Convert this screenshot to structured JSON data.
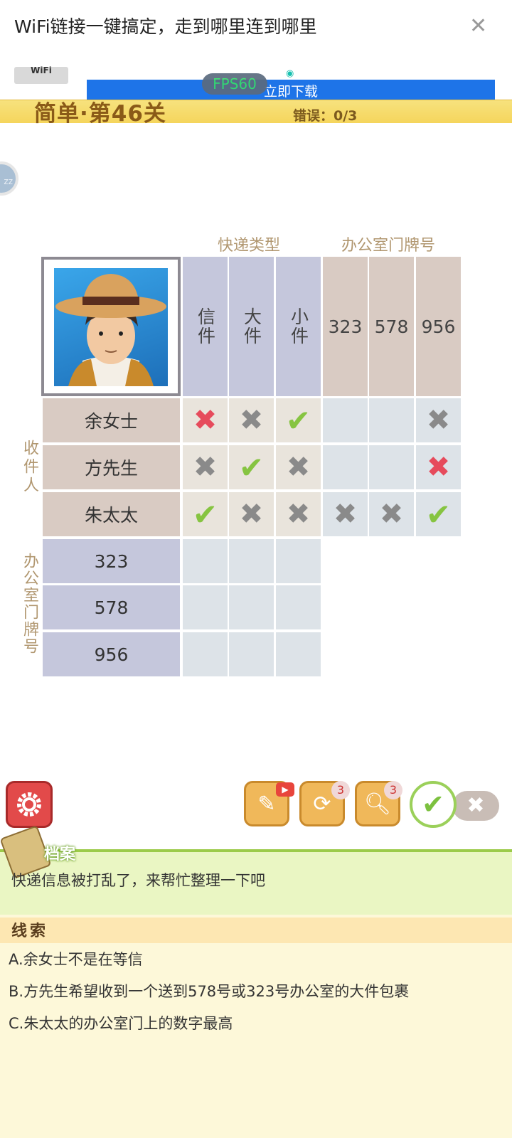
{
  "ad": {
    "title": "WiFi链接一键搞定，走到哪里连到哪里",
    "logo_text": "WiFi",
    "download_button": "立即下载",
    "close_icon": "close-icon"
  },
  "overlay": {
    "fps": "FPS60"
  },
  "level": {
    "title": "简单·第46关",
    "errors": "错误：0/3"
  },
  "grid": {
    "type_group_label": "快递类型",
    "room_group_label": "办公室门牌号",
    "type_columns": [
      "信件",
      "大件",
      "小件"
    ],
    "room_columns": [
      "323",
      "578",
      "956"
    ],
    "recipient_label": "收件人",
    "room_row_label": "办公室门牌号",
    "recipients": [
      "余女士",
      "方先生",
      "朱太太"
    ],
    "room_rows": [
      "323",
      "578",
      "956"
    ],
    "marks": {
      "row0": [
        "x-red",
        "x",
        "check",
        "",
        "",
        "x"
      ],
      "row1": [
        "x",
        "check",
        "x",
        "",
        "",
        "x-red"
      ],
      "row2": [
        "check",
        "x",
        "x",
        "x",
        "x",
        "check"
      ]
    },
    "mark_symbols": {
      "x": "✖",
      "x-red": "✖",
      "check": "✔"
    }
  },
  "toolbar": {
    "settings_icon": "gear-icon",
    "notes_icon": "notes-video-icon",
    "refresh_icon": "refresh-icon",
    "refresh_count": "3",
    "hint_icon": "magnifier-icon",
    "hint_count": "3",
    "confirm_symbol": "✔",
    "cancel_symbol": "✖"
  },
  "archive": {
    "tab_label": "档案",
    "text": "快递信息被打乱了，来帮忙整理一下吧"
  },
  "clues": {
    "title": "线索",
    "items": [
      "A.余女士不是在等信",
      "B.方先生希望收到一个送到578号或323号办公室的大件包裹",
      "C.朱太太的办公室门上的数字最高"
    ]
  },
  "colors": {
    "level_bar": "#f5d55c",
    "type_header": "#c5c7dc",
    "room_header": "#d9cbc3",
    "check": "#86c441",
    "cross_red": "#e64b5c",
    "archive_bg": "#eaf6c3",
    "clues_bg": "#fdf8d9"
  }
}
